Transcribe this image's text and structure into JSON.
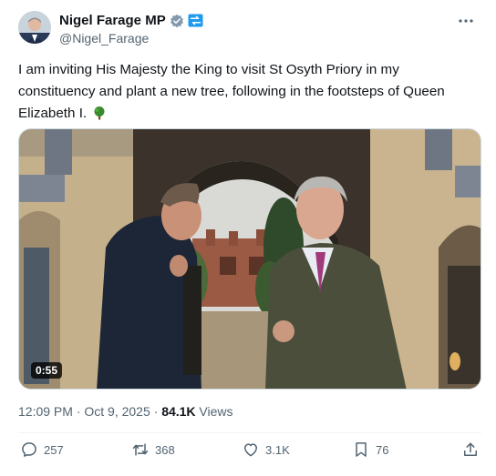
{
  "author": {
    "display_name": "Nigel Farage MP",
    "handle": "@Nigel_Farage",
    "verified_badge_icon": "grey-verified-badge-icon",
    "affiliate_badge_icon": "linked-account-badge-icon"
  },
  "tweet": {
    "text": "I am inviting His Majesty the King to visit St Osyth Priory in my constituency and plant a new tree, following in the footsteps of Queen Elizabeth I.",
    "emoji_icon": "tree-icon"
  },
  "media": {
    "type": "video",
    "duration": "0:55"
  },
  "meta": {
    "timestamp": "12:09 PM · Oct 9, 2025 · ",
    "views_count": "84.1K",
    "views_label": " Views"
  },
  "actions": {
    "replies": "257",
    "reposts": "368",
    "likes": "3.1K",
    "bookmarks": "76"
  },
  "colors": {
    "text_primary": "#0f1419",
    "text_secondary": "#536471",
    "divider": "#eff3f4",
    "badge_grey": "#829aab",
    "badge_blue": "#1d9bf0"
  }
}
